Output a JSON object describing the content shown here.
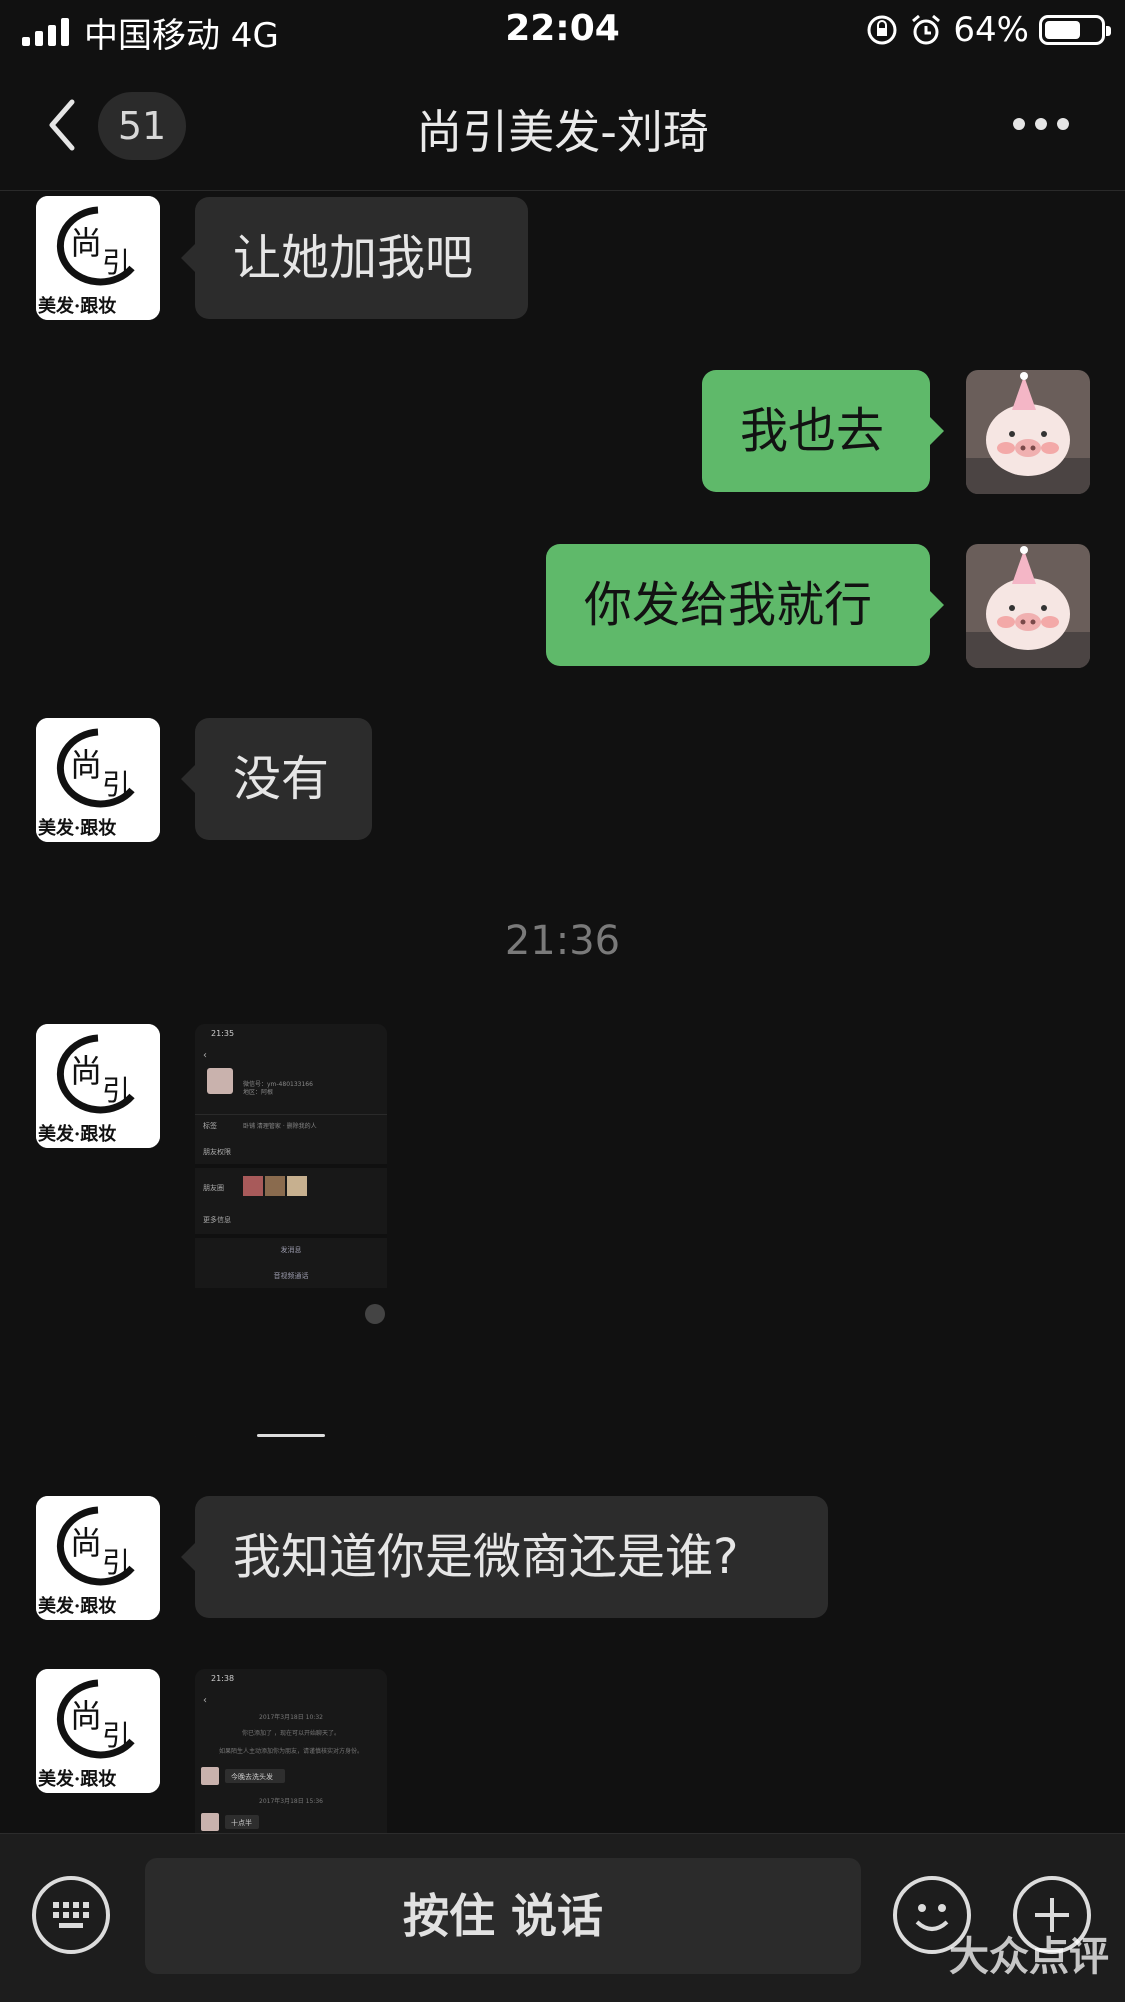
{
  "status_bar": {
    "carrier": "中国移动  4G",
    "time": "22:04",
    "battery": "64%",
    "battery_level": 0.64
  },
  "nav": {
    "unread_count": "51",
    "title": "尚引美发-刘琦"
  },
  "contact_avatar": {
    "brand_char1": "尚",
    "brand_char2": "引",
    "brand_text": "美发·跟妆"
  },
  "messages": [
    {
      "side": "in",
      "text": "让她加我吧"
    },
    {
      "side": "out",
      "text": "我也去"
    },
    {
      "side": "out",
      "text": "你发给我就行"
    },
    {
      "side": "in",
      "text": "没有"
    }
  ],
  "timestamp": "21:36",
  "screenshot1": {
    "time": "21:35",
    "wechat_id": "微信号：ym-480133166",
    "region": "地区：阿根",
    "tags_label": "标签",
    "tags_value": "卧铺 清理管家 · 删除我的人",
    "friend_perm": "朋友权限",
    "moments": "朋友圈",
    "more_info": "更多信息",
    "send_msg": "发消息",
    "call": "音视频通话"
  },
  "message_after": {
    "side": "in",
    "text": "我知道你是微商还是谁?"
  },
  "screenshot2": {
    "time": "21:38",
    "date1": "2017年3月18日 10:32",
    "sys1": "你已添加了 ，现在可以开始聊天了。",
    "sys2": "如果陌生人主动添加你为朋友，请谨慎核实对方身份。",
    "msg1": "今晚去洗头发",
    "date2": "2017年3月18日 15:36",
    "msg2": "十点半"
  },
  "bottom_bar": {
    "hold_to_talk": "按住 说话"
  },
  "watermark": "大众点评"
}
